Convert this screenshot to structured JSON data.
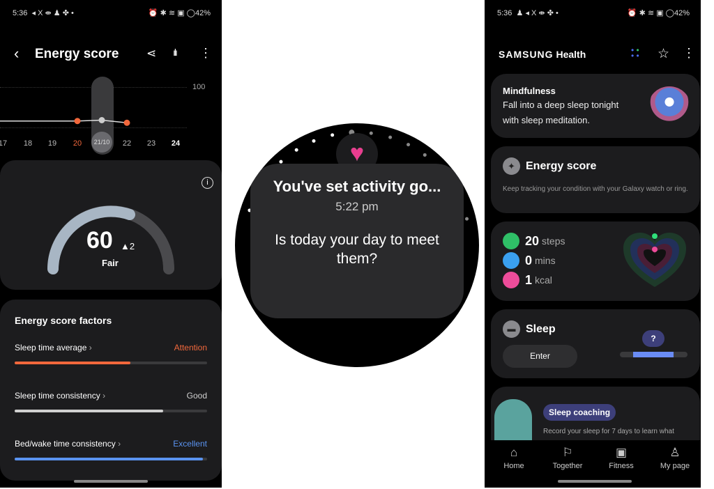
{
  "left": {
    "status": {
      "time": "5:36",
      "icons": "◂ X ⇼ ♟ ✤ •",
      "right": "⏰ ✱ ≋ ▣ ◯42%"
    },
    "title": "Energy score",
    "chart_data": {
      "type": "line",
      "x": [
        "17",
        "18",
        "19",
        "20",
        "21/10",
        "22",
        "23",
        "24"
      ],
      "values": [
        61,
        61,
        61,
        61,
        62,
        59,
        null,
        null
      ],
      "ytick": "100",
      "highlight_dates": [
        "20",
        "22"
      ],
      "selected": "21/10",
      "bold": "24"
    },
    "score": {
      "value": "60",
      "delta": "▲2",
      "label": "Fair",
      "gauge_fraction": 0.6
    },
    "factors": {
      "title": "Energy score factors",
      "items": [
        {
          "label": "Sleep time average",
          "status": "Attention",
          "color": "#f2683c",
          "fill": 0.6
        },
        {
          "label": "Sleep time consistency",
          "status": "Good",
          "color": "#d0d0d0",
          "fill": 0.77
        },
        {
          "label": "Bed/wake time consistency",
          "status": "Excellent",
          "color": "#5a93f0",
          "fill": 0.98
        }
      ]
    }
  },
  "watch": {
    "title": "You've set activity go...",
    "time": "5:22 pm",
    "message": "Is today your day to meet them?"
  },
  "right": {
    "status": {
      "time": "5:36",
      "icons": "♟ ◂ X ⇼ ✤ •",
      "right": "⏰ ✱ ≋ ▣ ◯42%"
    },
    "brand": "SAMSUNG",
    "app": "Health",
    "mind": {
      "title": "Mindfulness",
      "text": "Fall into a deep sleep tonight with sleep meditation."
    },
    "energy": {
      "title": "Energy score",
      "text": "Keep tracking your condition with your Galaxy watch or ring."
    },
    "activity": [
      {
        "value": "20",
        "unit": "steps",
        "color": "#2fbf67"
      },
      {
        "value": "0",
        "unit": "mins",
        "color": "#3aa0f0"
      },
      {
        "value": "1",
        "unit": "kcal",
        "color": "#ee4c9a"
      }
    ],
    "sleep": {
      "title": "Sleep",
      "button": "Enter",
      "bubble": "?"
    },
    "coaching": {
      "badge": "Sleep coaching",
      "text": "Record your sleep for 7 days to learn what"
    },
    "nav": [
      "Home",
      "Together",
      "Fitness",
      "My page"
    ]
  }
}
